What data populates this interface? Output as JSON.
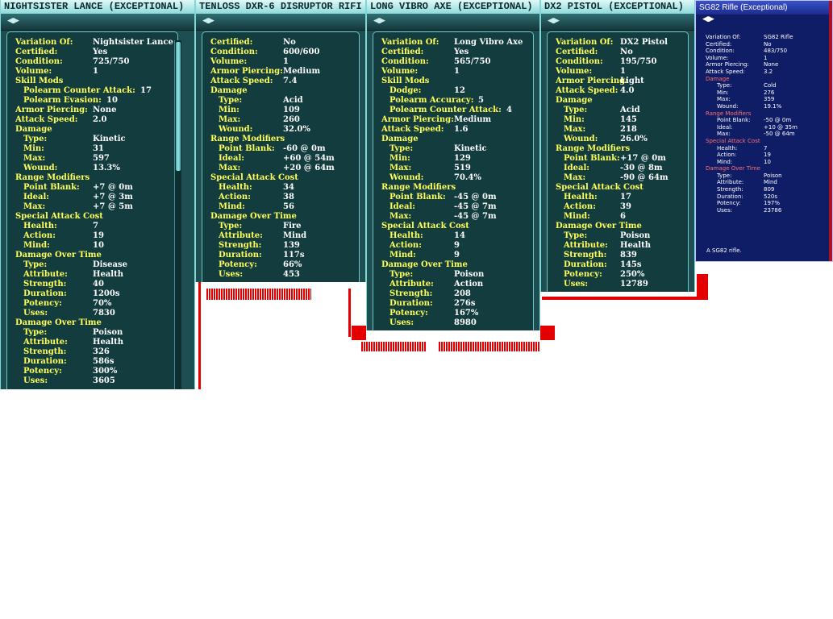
{
  "windows": [
    {
      "id": "nightsister",
      "title": "NIGHTSISTER LANCE (EXCEPTIONAL)",
      "rows": [
        {
          "label": "Variation Of:",
          "value": "Nightsister Lance"
        },
        {
          "label": "Certified:",
          "value": "Yes"
        },
        {
          "label": "Condition:",
          "value": "725/750"
        },
        {
          "label": "Volume:",
          "value": "1"
        },
        {
          "label": "Skill Mods",
          "value": ""
        },
        {
          "label": "Polearm Counter Attack:",
          "value": "17",
          "indent": true
        },
        {
          "label": "Polearm Evasion:",
          "value": "10",
          "indent": true
        },
        {
          "label": "Armor Piercing:",
          "value": "None"
        },
        {
          "label": "Attack Speed:",
          "value": "2.0"
        },
        {
          "label": "Damage",
          "value": ""
        },
        {
          "label": "Type:",
          "value": "Kinetic",
          "indent": true
        },
        {
          "label": "Min:",
          "value": "31",
          "indent": true
        },
        {
          "label": "Max:",
          "value": "597",
          "indent": true
        },
        {
          "label": "Wound:",
          "value": "13.3%",
          "indent": true
        },
        {
          "label": "Range Modifiers",
          "value": ""
        },
        {
          "label": "Point Blank:",
          "value": "+7 @ 0m",
          "indent": true
        },
        {
          "label": "Ideal:",
          "value": "+7 @ 3m",
          "indent": true
        },
        {
          "label": "Max:",
          "value": "+7 @ 5m",
          "indent": true
        },
        {
          "label": "Special Attack Cost",
          "value": ""
        },
        {
          "label": "Health:",
          "value": "7",
          "indent": true
        },
        {
          "label": "Action:",
          "value": "19",
          "indent": true
        },
        {
          "label": "Mind:",
          "value": "10",
          "indent": true
        },
        {
          "label": "Damage Over Time",
          "value": ""
        },
        {
          "label": "Type:",
          "value": "Disease",
          "indent": true
        },
        {
          "label": "Attribute:",
          "value": "Health",
          "indent": true
        },
        {
          "label": "Strength:",
          "value": "40",
          "indent": true
        },
        {
          "label": "Duration:",
          "value": "1200s",
          "indent": true
        },
        {
          "label": "Potency:",
          "value": "70%",
          "indent": true
        },
        {
          "label": "Uses:",
          "value": "7830",
          "indent": true
        },
        {
          "label": "Damage Over Time",
          "value": ""
        },
        {
          "label": "Type:",
          "value": "Poison",
          "indent": true
        },
        {
          "label": "Attribute:",
          "value": "Health",
          "indent": true
        },
        {
          "label": "Strength:",
          "value": "326",
          "indent": true
        },
        {
          "label": "Duration:",
          "value": "586s",
          "indent": true
        },
        {
          "label": "Potency:",
          "value": "300%",
          "indent": true
        },
        {
          "label": "Uses:",
          "value": "3605",
          "indent": true
        }
      ]
    },
    {
      "id": "tenloss",
      "title": "TENLOSS DXR-6 DISRUPTOR RIFI",
      "rows": [
        {
          "label": "Certified:",
          "value": "No"
        },
        {
          "label": "Condition:",
          "value": "600/600"
        },
        {
          "label": "Volume:",
          "value": "1"
        },
        {
          "label": "Armor Piercing:",
          "value": "Medium"
        },
        {
          "label": "Attack Speed:",
          "value": "7.4"
        },
        {
          "label": "Damage",
          "value": ""
        },
        {
          "label": "Type:",
          "value": "Acid",
          "indent": true
        },
        {
          "label": "Min:",
          "value": "109",
          "indent": true
        },
        {
          "label": "Max:",
          "value": "260",
          "indent": true
        },
        {
          "label": "Wound:",
          "value": "32.0%",
          "indent": true
        },
        {
          "label": "Range Modifiers",
          "value": ""
        },
        {
          "label": "Point Blank:",
          "value": "-60 @ 0m",
          "indent": true
        },
        {
          "label": "Ideal:",
          "value": "+60 @ 54m",
          "indent": true
        },
        {
          "label": "Max:",
          "value": "+20 @ 64m",
          "indent": true
        },
        {
          "label": "Special Attack Cost",
          "value": ""
        },
        {
          "label": "Health:",
          "value": "34",
          "indent": true
        },
        {
          "label": "Action:",
          "value": "38",
          "indent": true
        },
        {
          "label": "Mind:",
          "value": "56",
          "indent": true
        },
        {
          "label": "Damage Over Time",
          "value": ""
        },
        {
          "label": "Type:",
          "value": "Fire",
          "indent": true
        },
        {
          "label": "Attribute:",
          "value": "Mind",
          "indent": true
        },
        {
          "label": "Strength:",
          "value": "139",
          "indent": true
        },
        {
          "label": "Duration:",
          "value": "117s",
          "indent": true
        },
        {
          "label": "Potency:",
          "value": "66%",
          "indent": true
        },
        {
          "label": "Uses:",
          "value": "453",
          "indent": true
        }
      ]
    },
    {
      "id": "vibroaxe",
      "title": "LONG VIBRO AXE (EXCEPTIONAL)",
      "rows": [
        {
          "label": "Variation Of:",
          "value": "Long Vibro Axe"
        },
        {
          "label": "Certified:",
          "value": "Yes"
        },
        {
          "label": "Condition:",
          "value": "565/750"
        },
        {
          "label": "Volume:",
          "value": "1"
        },
        {
          "label": "Skill Mods",
          "value": ""
        },
        {
          "label": "Dodge:",
          "value": "12",
          "indent": true
        },
        {
          "label": "Polearm Accuracy:",
          "value": "5",
          "indent": true
        },
        {
          "label": "Polearm Counter Attack:",
          "value": "4",
          "indent": true
        },
        {
          "label": "Armor Piercing:",
          "value": "Medium"
        },
        {
          "label": "Attack Speed:",
          "value": "1.6"
        },
        {
          "label": "Damage",
          "value": ""
        },
        {
          "label": "Type:",
          "value": "Kinetic",
          "indent": true
        },
        {
          "label": "Min:",
          "value": "129",
          "indent": true
        },
        {
          "label": "Max:",
          "value": "519",
          "indent": true
        },
        {
          "label": "Wound:",
          "value": "70.4%",
          "indent": true
        },
        {
          "label": "Range Modifiers",
          "value": ""
        },
        {
          "label": "Point Blank:",
          "value": "-45 @ 0m",
          "indent": true
        },
        {
          "label": "Ideal:",
          "value": "-45 @ 7m",
          "indent": true
        },
        {
          "label": "Max:",
          "value": "-45 @ 7m",
          "indent": true
        },
        {
          "label": "Special Attack Cost",
          "value": ""
        },
        {
          "label": "Health:",
          "value": "14",
          "indent": true
        },
        {
          "label": "Action:",
          "value": "9",
          "indent": true
        },
        {
          "label": "Mind:",
          "value": "9",
          "indent": true
        },
        {
          "label": "Damage Over Time",
          "value": ""
        },
        {
          "label": "Type:",
          "value": "Poison",
          "indent": true
        },
        {
          "label": "Attribute:",
          "value": "Action",
          "indent": true
        },
        {
          "label": "Strength:",
          "value": "208",
          "indent": true
        },
        {
          "label": "Duration:",
          "value": "276s",
          "indent": true
        },
        {
          "label": "Potency:",
          "value": "167%",
          "indent": true
        },
        {
          "label": "Uses:",
          "value": "8980",
          "indent": true
        }
      ]
    },
    {
      "id": "dx2",
      "title": "DX2 PISTOL (EXCEPTIONAL)",
      "rows": [
        {
          "label": "Variation Of:",
          "value": "DX2 Pistol"
        },
        {
          "label": "Certified:",
          "value": "No"
        },
        {
          "label": "Condition:",
          "value": "195/750"
        },
        {
          "label": "Volume:",
          "value": "1"
        },
        {
          "label": "Armor Piercing:",
          "value": "Light"
        },
        {
          "label": "Attack Speed:",
          "value": "4.0"
        },
        {
          "label": "Damage",
          "value": ""
        },
        {
          "label": "Type:",
          "value": "Acid",
          "indent": true
        },
        {
          "label": "Min:",
          "value": "145",
          "indent": true
        },
        {
          "label": "Max:",
          "value": "218",
          "indent": true
        },
        {
          "label": "Wound:",
          "value": "26.0%",
          "indent": true
        },
        {
          "label": "Range Modifiers",
          "value": ""
        },
        {
          "label": "Point Blank:",
          "value": "+17 @ 0m",
          "indent": true
        },
        {
          "label": "Ideal:",
          "value": "-30 @ 8m",
          "indent": true
        },
        {
          "label": "Max:",
          "value": "-90 @ 64m",
          "indent": true
        },
        {
          "label": "Special Attack Cost",
          "value": ""
        },
        {
          "label": "Health:",
          "value": "17",
          "indent": true
        },
        {
          "label": "Action:",
          "value": "39",
          "indent": true
        },
        {
          "label": "Mind:",
          "value": "6",
          "indent": true
        },
        {
          "label": "Damage Over Time",
          "value": ""
        },
        {
          "label": "Type:",
          "value": "Poison",
          "indent": true
        },
        {
          "label": "Attribute:",
          "value": "Health",
          "indent": true
        },
        {
          "label": "Strength:",
          "value": "839",
          "indent": true
        },
        {
          "label": "Duration:",
          "value": "145s",
          "indent": true
        },
        {
          "label": "Potency:",
          "value": "250%",
          "indent": true
        },
        {
          "label": "Uses:",
          "value": "12789",
          "indent": true
        }
      ]
    },
    {
      "id": "sg82",
      "title": "SG82 Rifle (Exceptional)",
      "description": "A SG82 rifle.",
      "rows": [
        {
          "label": "Variation Of:",
          "value": "SG82 Rifle"
        },
        {
          "label": "Certified:",
          "value": "No"
        },
        {
          "label": "Condition:",
          "value": "483/750"
        },
        {
          "label": "Volume:",
          "value": "1"
        },
        {
          "label": "Armor Piercing:",
          "value": "None"
        },
        {
          "label": "Attack Speed:",
          "value": "3.2"
        },
        {
          "label": "Damage",
          "value": ""
        },
        {
          "label": "Type:",
          "value": "Cold",
          "indent": true
        },
        {
          "label": "Min:",
          "value": "276",
          "indent": true
        },
        {
          "label": "Max:",
          "value": "359",
          "indent": true
        },
        {
          "label": "Wound:",
          "value": "19.1%",
          "indent": true
        },
        {
          "label": "Range Modifiers",
          "value": ""
        },
        {
          "label": "Point Blank:",
          "value": "-50 @ 0m",
          "indent": true
        },
        {
          "label": "Ideal:",
          "value": "+10 @ 35m",
          "indent": true
        },
        {
          "label": "Max:",
          "value": "-50 @ 64m",
          "indent": true
        },
        {
          "label": "Special Attack Cost",
          "value": ""
        },
        {
          "label": "Health:",
          "value": "7",
          "indent": true
        },
        {
          "label": "Action:",
          "value": "19",
          "indent": true
        },
        {
          "label": "Mind:",
          "value": "10",
          "indent": true
        },
        {
          "label": "Damage Over Time",
          "value": ""
        },
        {
          "label": "Type:",
          "value": "Poison",
          "indent": true
        },
        {
          "label": "Attribute:",
          "value": "Mind",
          "indent": true
        },
        {
          "label": "Strength:",
          "value": "809",
          "indent": true
        },
        {
          "label": "Duration:",
          "value": "520s",
          "indent": true
        },
        {
          "label": "Potency:",
          "value": "197%",
          "indent": true
        },
        {
          "label": "Uses:",
          "value": "23786",
          "indent": true
        }
      ]
    }
  ],
  "nav_icon": "prev-next-arrows-icon",
  "nav_glyph": "◂●▸",
  "colors": {
    "teal_bg": "#1d4e52",
    "label_yellow": "#ffff55",
    "value_white": "#ffffff",
    "blue_bg": "#0f1d66",
    "blue_header": "#ff6f6f",
    "annotation_red": "#e40000"
  }
}
